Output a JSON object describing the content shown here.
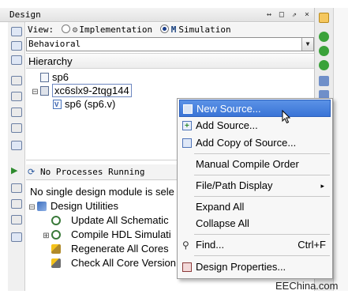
{
  "panel": {
    "title": "Design",
    "controls": "↔ □ ⇗ ×"
  },
  "view": {
    "label": "View:",
    "option_implementation": "Implementation",
    "option_simulation": "Simulation",
    "selected": "Simulation"
  },
  "behavior_select": {
    "value": "Behavioral"
  },
  "hierarchy": {
    "header": "Hierarchy",
    "items": [
      {
        "label": "sp6"
      },
      {
        "label": "xc6slx9-2tqg144"
      },
      {
        "label": "sp6 (sp6.v)"
      }
    ]
  },
  "processes": {
    "status": "No Processes Running",
    "message": "No single design module is sele",
    "items": [
      {
        "label": "Design Utilities"
      },
      {
        "label": "Update All Schematic"
      },
      {
        "label": "Compile HDL Simulati"
      },
      {
        "label": "Regenerate All Cores"
      },
      {
        "label": "Check All Core Version"
      }
    ]
  },
  "context_menu": {
    "items": [
      {
        "label": "New Source...",
        "highlighted": true
      },
      {
        "label": "Add Source..."
      },
      {
        "label": "Add Copy of Source..."
      },
      {
        "label": "Manual Compile Order"
      },
      {
        "label": "File/Path Display",
        "submenu": "▸"
      },
      {
        "label": "Expand All"
      },
      {
        "label": "Collapse All"
      },
      {
        "label": "Find...",
        "shortcut": "Ctrl+F"
      },
      {
        "label": "Design Properties..."
      }
    ]
  },
  "watermark": "EEChina.com",
  "colors": {
    "highlight": "#3a74d6",
    "menu_bg": "#f7f7f7"
  }
}
